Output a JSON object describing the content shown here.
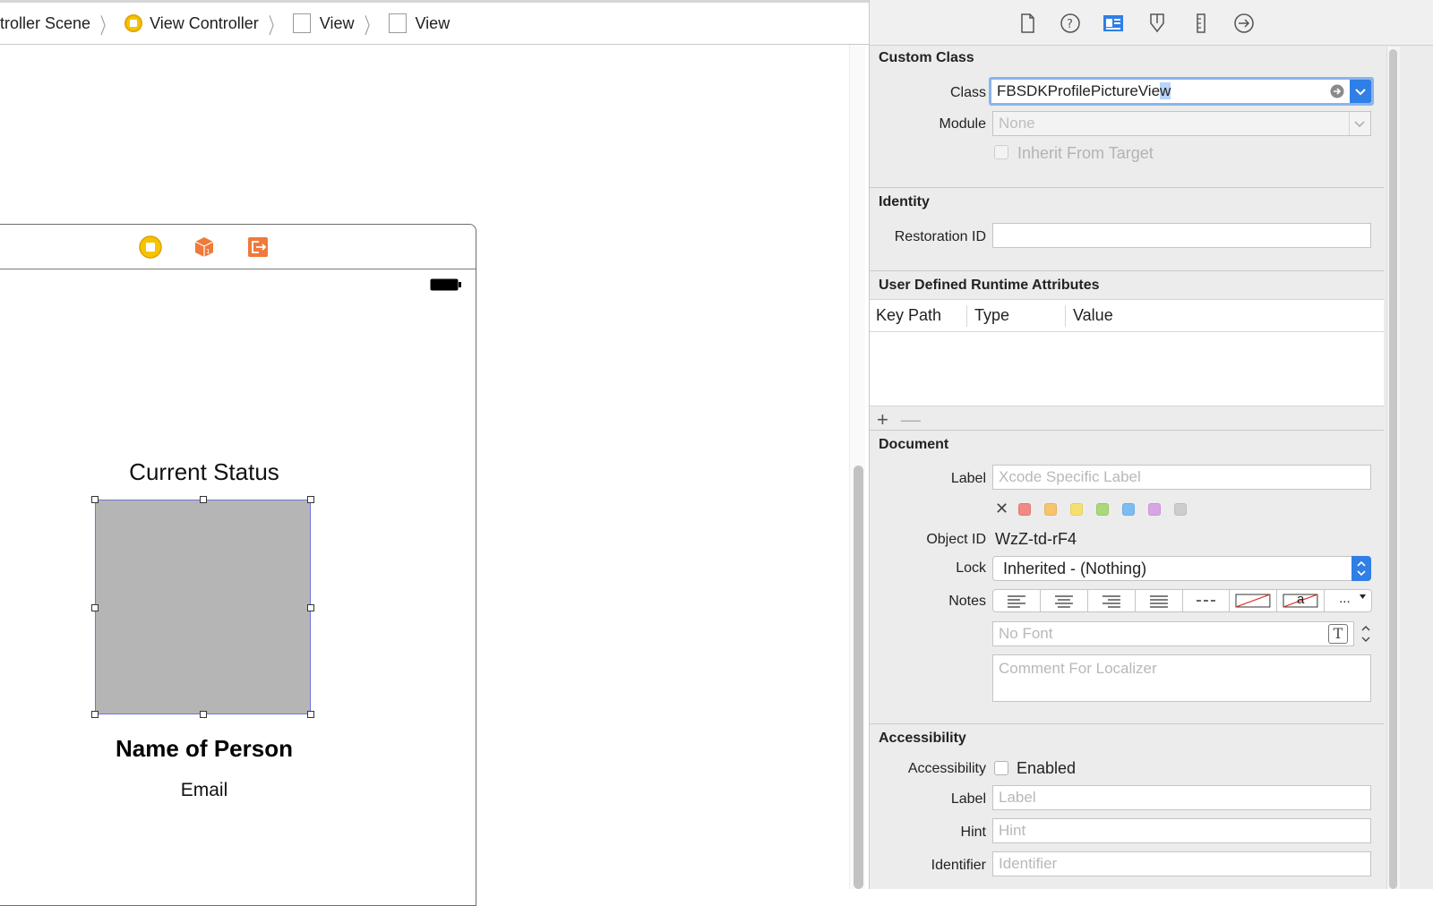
{
  "breadcrumb": {
    "items": [
      "troller Scene",
      "View Controller",
      "View",
      "View"
    ]
  },
  "scene": {
    "labels": {
      "status": "Current Status",
      "name": "Name of Person",
      "email": "Email"
    }
  },
  "inspector": {
    "tabs": [
      "file-inspector-icon",
      "quick-help-icon",
      "identity-inspector-icon",
      "attributes-inspector-icon",
      "size-inspector-icon",
      "connections-inspector-icon"
    ],
    "custom_class": {
      "title": "Custom Class",
      "class_label": "Class",
      "class_value_start": "FBSDKProfilePictureVie",
      "class_value_selected": "w",
      "module_label": "Module",
      "module_placeholder": "None",
      "inherit_label": "Inherit From Target"
    },
    "identity": {
      "title": "Identity",
      "restoration_label": "Restoration ID",
      "restoration_value": ""
    },
    "runtime_attributes": {
      "title": "User Defined Runtime Attributes",
      "columns": [
        "Key Path",
        "Type",
        "Value"
      ],
      "add": "+",
      "remove": "—"
    },
    "document": {
      "title": "Document",
      "label_label": "Label",
      "label_placeholder": "Xcode Specific Label",
      "clear_color": "✕",
      "colors": [
        "#f08a85",
        "#f6c46d",
        "#f4e070",
        "#a9d97a",
        "#7dbcf3",
        "#d8a6e6",
        "#cdcdcd"
      ],
      "object_id_label": "Object ID",
      "object_id": "WzZ-td-rF4",
      "lock_label": "Lock",
      "lock_value": "Inherited - (Nothing)",
      "notes_label": "Notes",
      "font_placeholder": "No Font",
      "font_button": "T",
      "comment_placeholder": "Comment For Localizer",
      "notes_more": "...",
      "notes_a": "a"
    },
    "accessibility": {
      "title": "Accessibility",
      "accessibility_label": "Accessibility",
      "enabled_label": "Enabled",
      "label_label": "Label",
      "label_placeholder": "Label",
      "hint_label": "Hint",
      "hint_placeholder": "Hint",
      "identifier_label": "Identifier",
      "identifier_placeholder": "Identifier"
    }
  },
  "colors": {
    "accent": "#2f7fe6",
    "selection_border": "#6d76e0",
    "picture_fill": "#b5b5b5",
    "vc_yellow": "#f5c400",
    "dock_orange": "#f07a3a"
  }
}
